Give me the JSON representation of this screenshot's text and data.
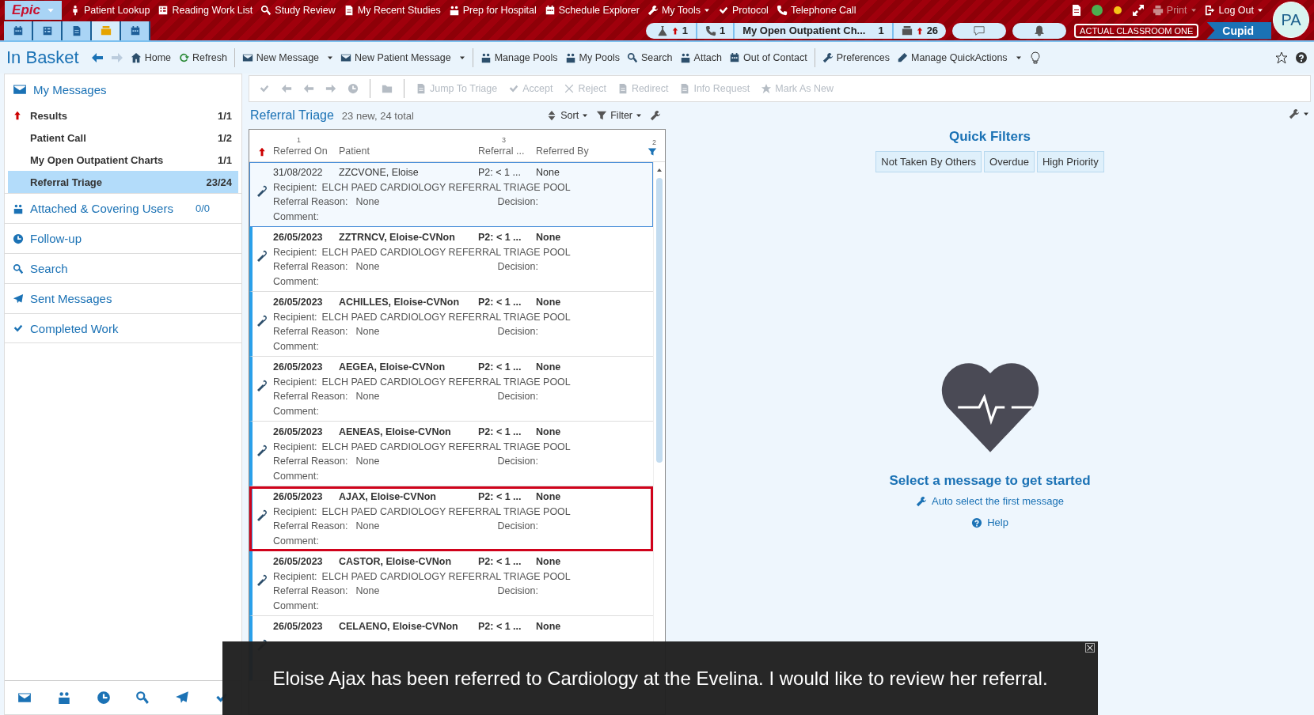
{
  "top_bar": {
    "logo": "Epic",
    "activities": [
      {
        "label": "Patient Lookup",
        "has_menu": false
      },
      {
        "label": "Reading Work List",
        "has_menu": false
      },
      {
        "label": "Study Review",
        "has_menu": false
      },
      {
        "label": "My Recent Studies",
        "has_menu": false
      },
      {
        "label": "Prep for Hospital",
        "has_menu": false
      },
      {
        "label": "Schedule Explorer",
        "has_menu": false
      },
      {
        "label": "My Tools",
        "has_menu": true
      },
      {
        "label": "Protocol",
        "has_menu": false
      },
      {
        "label": "Telephone Call",
        "has_menu": false
      }
    ],
    "print": {
      "label": "Print",
      "disabled": true
    },
    "logout": {
      "label": "Log Out"
    },
    "nav_buttons": [
      {
        "selected": false
      },
      {
        "selected": false
      },
      {
        "selected": false
      },
      {
        "selected": true
      },
      {
        "selected": false
      }
    ],
    "pills": [
      {
        "kind": "lab",
        "alert": true,
        "count": "1"
      },
      {
        "kind": "phone",
        "alert": false,
        "count": "1"
      },
      {
        "kind": "text",
        "label": "My Open Outpatient Ch...",
        "count": "1"
      },
      {
        "kind": "inbox",
        "alert": true,
        "count": "26"
      },
      {
        "kind": "chat"
      },
      {
        "kind": "bell"
      }
    ],
    "environment": "ACTUAL CLASSROOM ONE",
    "user": "Cupid",
    "avatar": "PA"
  },
  "header": {
    "title": "In Basket",
    "tools": [
      {
        "label": "Home",
        "has_menu": false
      },
      {
        "label": "Refresh",
        "has_menu": false
      },
      {
        "label": "New Message",
        "has_menu": true
      },
      {
        "label": "New Patient Message",
        "has_menu": true
      },
      {
        "label": "Manage Pools",
        "has_menu": false
      },
      {
        "label": "My Pools",
        "has_menu": false
      },
      {
        "label": "Search",
        "has_menu": false
      },
      {
        "label": "Attach",
        "has_menu": false
      },
      {
        "label": "Out of Contact",
        "has_menu": false
      },
      {
        "label": "Preferences",
        "has_menu": false
      },
      {
        "label": "Manage QuickActions",
        "has_menu": true
      }
    ]
  },
  "sidebar": {
    "title": "My Messages",
    "folders": [
      {
        "label": "Results",
        "count": "1/1",
        "alert": true,
        "selected": false
      },
      {
        "label": "Patient Call",
        "count": "1/2",
        "alert": false,
        "selected": false
      },
      {
        "label": "My Open Outpatient Charts",
        "count": "1/1",
        "alert": false,
        "selected": false
      },
      {
        "label": "Referral Triage",
        "count": "23/24",
        "alert": false,
        "selected": true
      }
    ],
    "sections": [
      {
        "label": "Attached & Covering Users",
        "count": "0/0"
      },
      {
        "label": "Follow-up"
      },
      {
        "label": "Search"
      },
      {
        "label": "Sent Messages"
      },
      {
        "label": "Completed Work"
      }
    ]
  },
  "actions": [
    {
      "kind": "icon",
      "disabled": true
    },
    {
      "kind": "icon",
      "disabled": true
    },
    {
      "kind": "icon",
      "disabled": true
    },
    {
      "kind": "icon",
      "disabled": true
    },
    {
      "kind": "icon",
      "disabled": true
    },
    {
      "kind": "icon",
      "disabled": true
    },
    {
      "kind": "text",
      "label": "Jump To Triage",
      "disabled": true
    },
    {
      "kind": "text",
      "label": "Accept",
      "disabled": true
    },
    {
      "kind": "text",
      "label": "Reject",
      "disabled": true
    },
    {
      "kind": "text",
      "label": "Redirect",
      "disabled": true
    },
    {
      "kind": "text",
      "label": "Info Request",
      "disabled": true
    },
    {
      "kind": "text",
      "label": "Mark As New",
      "disabled": true
    }
  ],
  "list": {
    "title": "Referral Triage",
    "summary": "23 new, 24 total",
    "sort": "Sort",
    "filter": "Filter",
    "columns": [
      {
        "label": "Referred On",
        "rank": "1"
      },
      {
        "label": "Patient"
      },
      {
        "label": "Referral ...",
        "rank": "3"
      },
      {
        "label": "Referred By"
      }
    ],
    "filter_rank": "2",
    "rows": [
      {
        "date": "31/08/2022",
        "patient": "ZZCVONE, Eloise",
        "priority": "P2: < 1 ...",
        "referred_by": "None",
        "recipient_label": "Recipient:",
        "recipient": "ELCH PAED CARDIOLOGY REFERRAL TRIAGE POOL",
        "reason_label": "Referral Reason:",
        "reason": "None",
        "decision_label": "Decision:",
        "comment_label": "Comment:",
        "unread": false,
        "selected": true,
        "highlighted": false
      },
      {
        "date": "26/05/2023",
        "patient": "ZZTRNCV, Eloise-CVNon",
        "priority": "P2: < 1 ...",
        "referred_by": "None",
        "recipient_label": "Recipient:",
        "recipient": "ELCH PAED CARDIOLOGY REFERRAL TRIAGE POOL",
        "reason_label": "Referral Reason:",
        "reason": "None",
        "decision_label": "Decision:",
        "comment_label": "Comment:",
        "unread": true,
        "selected": false,
        "highlighted": false
      },
      {
        "date": "26/05/2023",
        "patient": "ACHILLES, Eloise-CVNon",
        "priority": "P2: < 1 ...",
        "referred_by": "None",
        "recipient_label": "Recipient:",
        "recipient": "ELCH PAED CARDIOLOGY REFERRAL TRIAGE POOL",
        "reason_label": "Referral Reason:",
        "reason": "None",
        "decision_label": "Decision:",
        "comment_label": "Comment:",
        "unread": true,
        "selected": false,
        "highlighted": false
      },
      {
        "date": "26/05/2023",
        "patient": "AEGEA, Eloise-CVNon",
        "priority": "P2: < 1 ...",
        "referred_by": "None",
        "recipient_label": "Recipient:",
        "recipient": "ELCH PAED CARDIOLOGY REFERRAL TRIAGE POOL",
        "reason_label": "Referral Reason:",
        "reason": "None",
        "decision_label": "Decision:",
        "comment_label": "Comment:",
        "unread": true,
        "selected": false,
        "highlighted": false
      },
      {
        "date": "26/05/2023",
        "patient": "AENEAS, Eloise-CVNon",
        "priority": "P2: < 1 ...",
        "referred_by": "None",
        "recipient_label": "Recipient:",
        "recipient": "ELCH PAED CARDIOLOGY REFERRAL TRIAGE POOL",
        "reason_label": "Referral Reason:",
        "reason": "None",
        "decision_label": "Decision:",
        "comment_label": "Comment:",
        "unread": true,
        "selected": false,
        "highlighted": false
      },
      {
        "date": "26/05/2023",
        "patient": "AJAX, Eloise-CVNon",
        "priority": "P2: < 1 ...",
        "referred_by": "None",
        "recipient_label": "Recipient:",
        "recipient": "ELCH PAED CARDIOLOGY REFERRAL TRIAGE POOL",
        "reason_label": "Referral Reason:",
        "reason": "None",
        "decision_label": "Decision:",
        "comment_label": "Comment:",
        "unread": true,
        "selected": false,
        "highlighted": true
      },
      {
        "date": "26/05/2023",
        "patient": "CASTOR, Eloise-CVNon",
        "priority": "P2: < 1 ...",
        "referred_by": "None",
        "recipient_label": "Recipient:",
        "recipient": "ELCH PAED CARDIOLOGY REFERRAL TRIAGE POOL",
        "reason_label": "Referral Reason:",
        "reason": "None",
        "decision_label": "Decision:",
        "comment_label": "Comment:",
        "unread": true,
        "selected": false,
        "highlighted": false
      },
      {
        "date": "26/05/2023",
        "patient": "CELAENO, Eloise-CVNon",
        "priority": "P2: < 1 ...",
        "referred_by": "None",
        "unread": true,
        "selected": false,
        "highlighted": false
      }
    ]
  },
  "quick_filters": {
    "title": "Quick Filters",
    "filters": [
      {
        "label": "Not Taken By Others"
      },
      {
        "label": "Overdue"
      },
      {
        "label": "High Priority"
      }
    ]
  },
  "empty_state": {
    "title": "Select a message to get started",
    "auto_select": "Auto select the first message",
    "help": "Help"
  },
  "caption": {
    "text": "Eloise Ajax has been referred to Cardiology at the Evelina. I would like to review her referral."
  }
}
